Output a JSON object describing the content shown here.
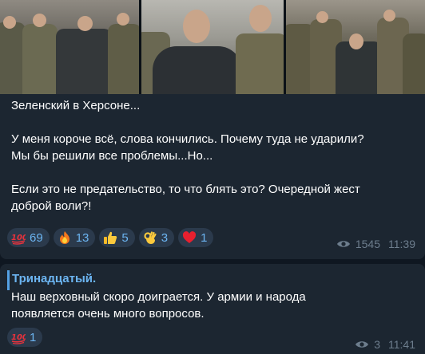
{
  "post": {
    "text_lines": [
      "Зеленский в Херсоне...",
      "",
      "У меня короче всё, слова кончились. Почему туда не ударили?",
      "Мы бы решили все проблемы...Но...",
      "",
      "Если это не предательство, то что блять это? Очередной жест",
      "доброй воли?!"
    ],
    "reactions": [
      {
        "emoji": "hundred-points-icon",
        "count": "69"
      },
      {
        "emoji": "fire-icon",
        "count": "13"
      },
      {
        "emoji": "thumbs-up-icon",
        "count": "5"
      },
      {
        "emoji": "ok-hand-icon",
        "count": "3"
      },
      {
        "emoji": "heart-icon",
        "count": "1"
      }
    ],
    "views": "1545",
    "time": "11:39"
  },
  "reply": {
    "author": "Тринадцатый.",
    "text_lines": [
      "Наш верховный скоро доиграется. У армии и народа",
      "появляется очень много вопросов."
    ],
    "reactions": [
      {
        "emoji": "hundred-points-icon",
        "count": "1"
      }
    ],
    "views": "3",
    "time": "11:41"
  },
  "colors": {
    "background": "#0f1721",
    "bubble": "#1c2631",
    "reaction_bg": "#2b3a4c",
    "accent": "#6cb5f2",
    "meta": "#6d7d8d"
  }
}
